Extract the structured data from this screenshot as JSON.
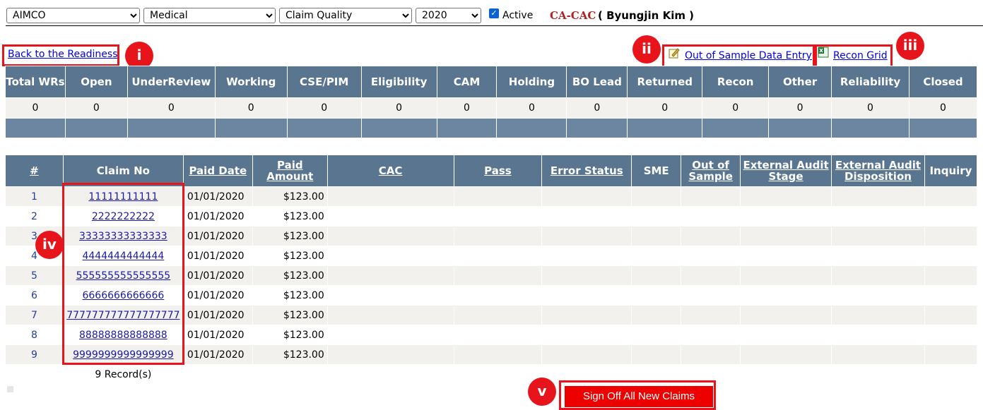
{
  "filters": {
    "company": "AIMCO",
    "line": "Medical",
    "category": "Claim Quality",
    "year": "2020",
    "active_label": "Active",
    "active_checked": true
  },
  "header": {
    "code": "CA-CAC",
    "user": "( Byungjin Kim )"
  },
  "links": {
    "back": "Back to the Readiness",
    "out_of_sample": "Out of Sample Data Entry",
    "recon_grid": "Recon Grid"
  },
  "badges": [
    "i",
    "ii",
    "iii",
    "iv",
    "v"
  ],
  "stats": {
    "headers": [
      "Total WRs",
      "Open",
      "UnderReview",
      "Working",
      "CSE/PIM",
      "Eligibility",
      "CAM",
      "Holding",
      "BO Lead",
      "Returned",
      "Recon",
      "Other",
      "Reliability",
      "Closed"
    ],
    "values": [
      "0",
      "0",
      "0",
      "0",
      "0",
      "0",
      "0",
      "0",
      "0",
      "0",
      "0",
      "0",
      "0",
      "0"
    ]
  },
  "claims": {
    "headers": [
      "#",
      "Claim No",
      "Paid Date",
      "Paid Amount",
      "CAC",
      "Pass",
      "Error Status",
      "SME",
      "Out of Sample",
      "External Audit Stage",
      "External Audit Disposition",
      "Inquiry"
    ],
    "rows": [
      {
        "n": "1",
        "claim": "11111111111",
        "date": "01/01/2020",
        "amount": "$123.00"
      },
      {
        "n": "2",
        "claim": "2222222222",
        "date": "01/01/2020",
        "amount": "$123.00"
      },
      {
        "n": "3",
        "claim": "33333333333333",
        "date": "01/01/2020",
        "amount": "$123.00"
      },
      {
        "n": "4",
        "claim": "4444444444444",
        "date": "01/01/2020",
        "amount": "$123.00"
      },
      {
        "n": "5",
        "claim": "555555555555555",
        "date": "01/01/2020",
        "amount": "$123.00"
      },
      {
        "n": "6",
        "claim": "6666666666666",
        "date": "01/01/2020",
        "amount": "$123.00"
      },
      {
        "n": "7",
        "claim": "777777777777777777",
        "date": "01/01/2020",
        "amount": "$123.00"
      },
      {
        "n": "8",
        "claim": "88888888888888",
        "date": "01/01/2020",
        "amount": "$123.00"
      },
      {
        "n": "9",
        "claim": "9999999999999999",
        "date": "01/01/2020",
        "amount": "$123.00"
      }
    ],
    "footer": "9 Record(s)"
  },
  "sign_off": "Sign Off All New Claims",
  "colors": {
    "accent_red": "#e8141c",
    "header_blue": "#597590",
    "title_red": "#b22222"
  }
}
